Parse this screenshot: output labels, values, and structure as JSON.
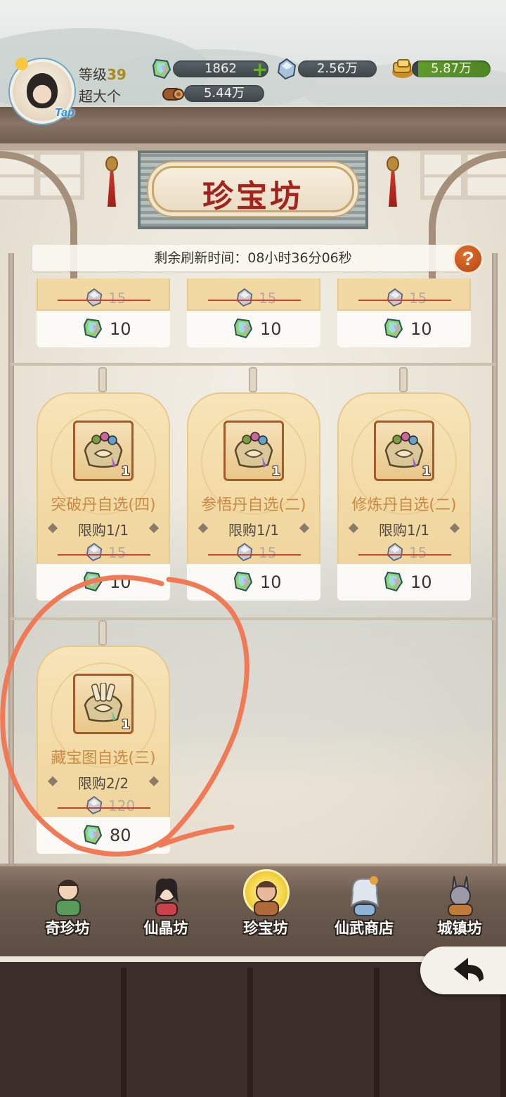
{
  "player": {
    "level_label": "等级",
    "level_value": "39",
    "nickname": "超大个",
    "avatar_badge": "Tap"
  },
  "resources": [
    {
      "name": "jade-crystal",
      "value": "1862",
      "has_plus": true
    },
    {
      "name": "silver-crystal",
      "value": "2.56万"
    },
    {
      "name": "gold-ingot",
      "value": "5.87万"
    },
    {
      "name": "wood",
      "value": "5.44万"
    }
  ],
  "shop": {
    "title": "珍宝坊",
    "refresh_text": "剩余刷新时间：08小时36分06秒",
    "help_label": "?"
  },
  "top_row_items": [
    {
      "old_price": "15",
      "price": "10"
    },
    {
      "old_price": "15",
      "price": "10"
    },
    {
      "old_price": "15",
      "price": "10"
    }
  ],
  "items": [
    {
      "name": "突破丹自选(四)",
      "limit": "限购1/1",
      "old_price": "15",
      "price": "10",
      "qty": "1"
    },
    {
      "name": "参悟丹自选(二)",
      "limit": "限购1/1",
      "old_price": "15",
      "price": "10",
      "qty": "1"
    },
    {
      "name": "修炼丹自选(二)",
      "limit": "限购1/1",
      "old_price": "15",
      "price": "10",
      "qty": "1"
    },
    {
      "name": "藏宝图自选(三)",
      "limit": "限购2/2",
      "old_price": "120",
      "price": "80",
      "qty": "1"
    }
  ],
  "nav": {
    "tabs": [
      {
        "label": "奇珍坊"
      },
      {
        "label": "仙晶坊"
      },
      {
        "label": "珍宝坊",
        "active": true
      },
      {
        "label": "仙武商店"
      },
      {
        "label": "城镇坊"
      }
    ]
  },
  "colors": {
    "accent_red": "#a3231e",
    "card_gold": "#f2d9a3",
    "annotation": "#f07a55",
    "active_tab": "#f5d64a"
  },
  "icons": [
    "jade-gem-icon",
    "silver-gem-icon",
    "gold-ingot-icon",
    "wood-icon",
    "plus-icon",
    "help-icon",
    "back-arrow-icon"
  ]
}
